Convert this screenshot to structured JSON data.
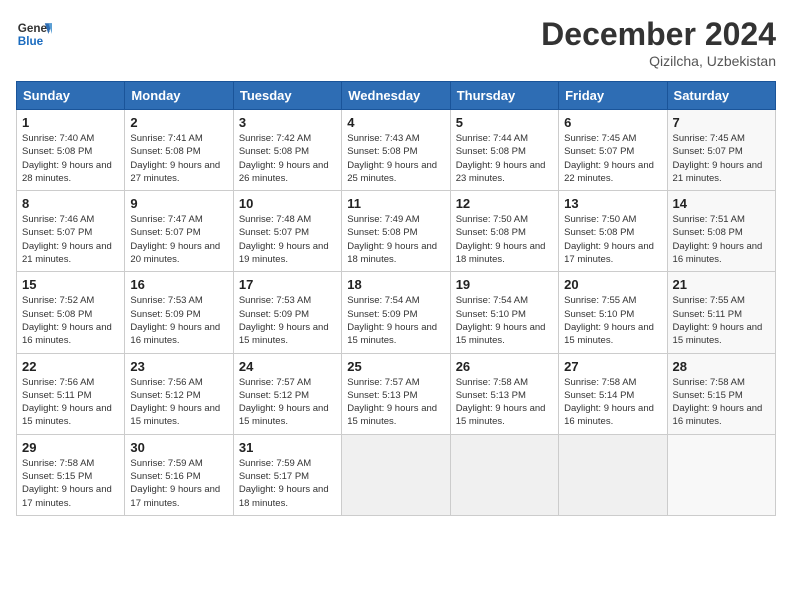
{
  "header": {
    "logo_line1": "General",
    "logo_line2": "Blue",
    "month": "December 2024",
    "location": "Qizilcha, Uzbekistan"
  },
  "days_of_week": [
    "Sunday",
    "Monday",
    "Tuesday",
    "Wednesday",
    "Thursday",
    "Friday",
    "Saturday"
  ],
  "weeks": [
    [
      {
        "day": 1,
        "sunrise": "7:40 AM",
        "sunset": "5:08 PM",
        "daylight": "9 hours and 28 minutes"
      },
      {
        "day": 2,
        "sunrise": "7:41 AM",
        "sunset": "5:08 PM",
        "daylight": "9 hours and 27 minutes"
      },
      {
        "day": 3,
        "sunrise": "7:42 AM",
        "sunset": "5:08 PM",
        "daylight": "9 hours and 26 minutes"
      },
      {
        "day": 4,
        "sunrise": "7:43 AM",
        "sunset": "5:08 PM",
        "daylight": "9 hours and 25 minutes"
      },
      {
        "day": 5,
        "sunrise": "7:44 AM",
        "sunset": "5:08 PM",
        "daylight": "9 hours and 23 minutes"
      },
      {
        "day": 6,
        "sunrise": "7:45 AM",
        "sunset": "5:07 PM",
        "daylight": "9 hours and 22 minutes"
      },
      {
        "day": 7,
        "sunrise": "7:45 AM",
        "sunset": "5:07 PM",
        "daylight": "9 hours and 21 minutes"
      }
    ],
    [
      {
        "day": 8,
        "sunrise": "7:46 AM",
        "sunset": "5:07 PM",
        "daylight": "9 hours and 21 minutes"
      },
      {
        "day": 9,
        "sunrise": "7:47 AM",
        "sunset": "5:07 PM",
        "daylight": "9 hours and 20 minutes"
      },
      {
        "day": 10,
        "sunrise": "7:48 AM",
        "sunset": "5:07 PM",
        "daylight": "9 hours and 19 minutes"
      },
      {
        "day": 11,
        "sunrise": "7:49 AM",
        "sunset": "5:08 PM",
        "daylight": "9 hours and 18 minutes"
      },
      {
        "day": 12,
        "sunrise": "7:50 AM",
        "sunset": "5:08 PM",
        "daylight": "9 hours and 18 minutes"
      },
      {
        "day": 13,
        "sunrise": "7:50 AM",
        "sunset": "5:08 PM",
        "daylight": "9 hours and 17 minutes"
      },
      {
        "day": 14,
        "sunrise": "7:51 AM",
        "sunset": "5:08 PM",
        "daylight": "9 hours and 16 minutes"
      }
    ],
    [
      {
        "day": 15,
        "sunrise": "7:52 AM",
        "sunset": "5:08 PM",
        "daylight": "9 hours and 16 minutes"
      },
      {
        "day": 16,
        "sunrise": "7:53 AM",
        "sunset": "5:09 PM",
        "daylight": "9 hours and 16 minutes"
      },
      {
        "day": 17,
        "sunrise": "7:53 AM",
        "sunset": "5:09 PM",
        "daylight": "9 hours and 15 minutes"
      },
      {
        "day": 18,
        "sunrise": "7:54 AM",
        "sunset": "5:09 PM",
        "daylight": "9 hours and 15 minutes"
      },
      {
        "day": 19,
        "sunrise": "7:54 AM",
        "sunset": "5:10 PM",
        "daylight": "9 hours and 15 minutes"
      },
      {
        "day": 20,
        "sunrise": "7:55 AM",
        "sunset": "5:10 PM",
        "daylight": "9 hours and 15 minutes"
      },
      {
        "day": 21,
        "sunrise": "7:55 AM",
        "sunset": "5:11 PM",
        "daylight": "9 hours and 15 minutes"
      }
    ],
    [
      {
        "day": 22,
        "sunrise": "7:56 AM",
        "sunset": "5:11 PM",
        "daylight": "9 hours and 15 minutes"
      },
      {
        "day": 23,
        "sunrise": "7:56 AM",
        "sunset": "5:12 PM",
        "daylight": "9 hours and 15 minutes"
      },
      {
        "day": 24,
        "sunrise": "7:57 AM",
        "sunset": "5:12 PM",
        "daylight": "9 hours and 15 minutes"
      },
      {
        "day": 25,
        "sunrise": "7:57 AM",
        "sunset": "5:13 PM",
        "daylight": "9 hours and 15 minutes"
      },
      {
        "day": 26,
        "sunrise": "7:58 AM",
        "sunset": "5:13 PM",
        "daylight": "9 hours and 15 minutes"
      },
      {
        "day": 27,
        "sunrise": "7:58 AM",
        "sunset": "5:14 PM",
        "daylight": "9 hours and 16 minutes"
      },
      {
        "day": 28,
        "sunrise": "7:58 AM",
        "sunset": "5:15 PM",
        "daylight": "9 hours and 16 minutes"
      }
    ],
    [
      {
        "day": 29,
        "sunrise": "7:58 AM",
        "sunset": "5:15 PM",
        "daylight": "9 hours and 17 minutes"
      },
      {
        "day": 30,
        "sunrise": "7:59 AM",
        "sunset": "5:16 PM",
        "daylight": "9 hours and 17 minutes"
      },
      {
        "day": 31,
        "sunrise": "7:59 AM",
        "sunset": "5:17 PM",
        "daylight": "9 hours and 18 minutes"
      },
      null,
      null,
      null,
      null
    ]
  ]
}
